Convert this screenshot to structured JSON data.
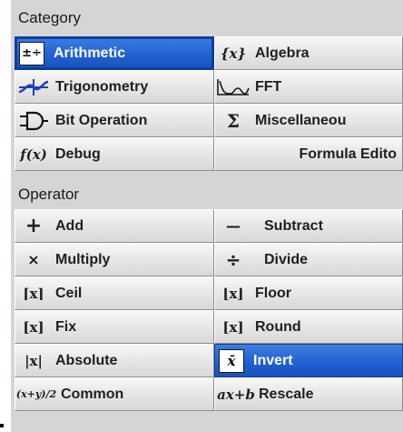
{
  "category": {
    "title": "Category",
    "items": [
      {
        "label": "Arithmetic",
        "icon": "arithmetic-icon",
        "glyph": "±÷"
      },
      {
        "label": "Algebra",
        "icon": "algebra-icon",
        "glyph": "{x}"
      },
      {
        "label": "Trigonometry",
        "icon": "sine-wave-icon",
        "glyph": "∿"
      },
      {
        "label": "FFT",
        "icon": "fft-spectrum-icon",
        "glyph": "⌇∿"
      },
      {
        "label": "Bit Operation",
        "icon": "logic-gate-icon",
        "glyph": "⊃"
      },
      {
        "label": "Miscellaneou",
        "icon": "sigma-icon",
        "glyph": "Σ"
      },
      {
        "label": "Debug",
        "icon": "function-icon",
        "glyph": "f(x)"
      },
      {
        "label": "Formula Edito",
        "icon": "",
        "glyph": ""
      }
    ]
  },
  "operator": {
    "title": "Operator",
    "items": [
      {
        "label": "Add",
        "icon": "plus-icon",
        "glyph": "+"
      },
      {
        "label": "Subtract",
        "icon": "minus-icon",
        "glyph": "—"
      },
      {
        "label": "Multiply",
        "icon": "multiply-icon",
        "glyph": "×"
      },
      {
        "label": "Divide",
        "icon": "divide-icon",
        "glyph": "÷"
      },
      {
        "label": "Ceil",
        "icon": "ceil-icon",
        "glyph": "⌈x⌉"
      },
      {
        "label": "Floor",
        "icon": "floor-icon",
        "glyph": "⌊x⌋"
      },
      {
        "label": "Fix",
        "icon": "fix-icon",
        "glyph": "[x]"
      },
      {
        "label": "Round",
        "icon": "round-icon",
        "glyph": "[x]"
      },
      {
        "label": "Absolute",
        "icon": "absolute-icon",
        "glyph": "|x|"
      },
      {
        "label": "Invert",
        "icon": "invert-icon",
        "glyph": "x̄"
      },
      {
        "label": "Common",
        "icon": "common-icon",
        "glyph": "(x+y)/2"
      },
      {
        "label": "Rescale",
        "icon": "rescale-icon",
        "glyph": "ax+b"
      }
    ]
  },
  "colors": {
    "panel": "#d6d5d3",
    "selected": "#1f5fd0",
    "selected_text": "#ffffff"
  }
}
